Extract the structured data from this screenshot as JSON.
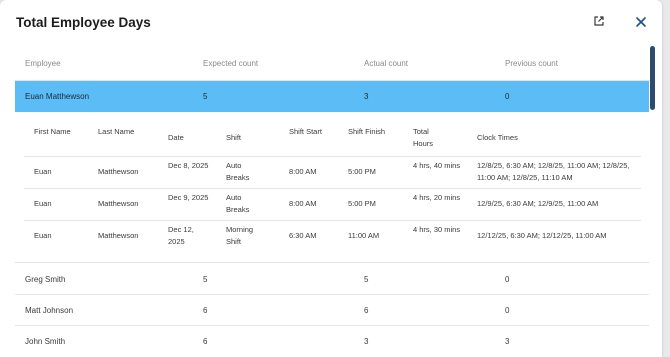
{
  "dialog": {
    "title": "Total Employee Days"
  },
  "columns": {
    "employee": "Employee",
    "expected": "Expected count",
    "actual": "Actual count",
    "previous": "Previous count"
  },
  "selected_row": {
    "employee": "Euan Matthewson",
    "expected": "5",
    "actual": "3",
    "previous": "0"
  },
  "detail": {
    "headers": {
      "first_name": "First Name",
      "last_name": "Last Name",
      "date": "Date",
      "shift": "Shift",
      "shift_start": "Shift Start",
      "shift_finish": "Shift Finish",
      "total_hours": "Total Hours",
      "clock_times": "Clock Times"
    },
    "rows": [
      {
        "first_name": "Euan",
        "last_name": "Matthewson",
        "date": "Dec 8, 2025",
        "shift": "Auto Breaks",
        "shift_start": "8:00 AM",
        "shift_finish": "5:00 PM",
        "total_hours": "4 hrs, 40 mins",
        "clock_times": "12/8/25, 6:30 AM; 12/8/25, 11:00 AM; 12/8/25, 11:00 AM; 12/8/25, 11:10 AM"
      },
      {
        "first_name": "Euan",
        "last_name": "Matthewson",
        "date": "Dec 9, 2025",
        "shift": "Auto Breaks",
        "shift_start": "8:00 AM",
        "shift_finish": "5:00 PM",
        "total_hours": "4 hrs, 20 mins",
        "clock_times": "12/9/25, 6:30 AM; 12/9/25, 11:00 AM"
      },
      {
        "first_name": "Euan",
        "last_name": "Matthewson",
        "date": "Dec 12, 2025",
        "shift": "Morning Shift",
        "shift_start": "6:30 AM",
        "shift_finish": "11:00 AM",
        "total_hours": "4 hrs, 30 mins",
        "clock_times": "12/12/25, 6:30 AM; 12/12/25, 11:00 AM"
      }
    ]
  },
  "other_rows": [
    {
      "employee": "Greg Smith",
      "expected": "5",
      "actual": "5",
      "previous": "0"
    },
    {
      "employee": "Matt Johnson",
      "expected": "6",
      "actual": "6",
      "previous": "0"
    },
    {
      "employee": "John Smith",
      "expected": "6",
      "actual": "3",
      "previous": "3"
    }
  ],
  "icons": {
    "popout": "external-link-icon",
    "close": "close-icon"
  },
  "colors": {
    "selected_row": "#5bbcf6",
    "accent": "#2f4a6d"
  }
}
